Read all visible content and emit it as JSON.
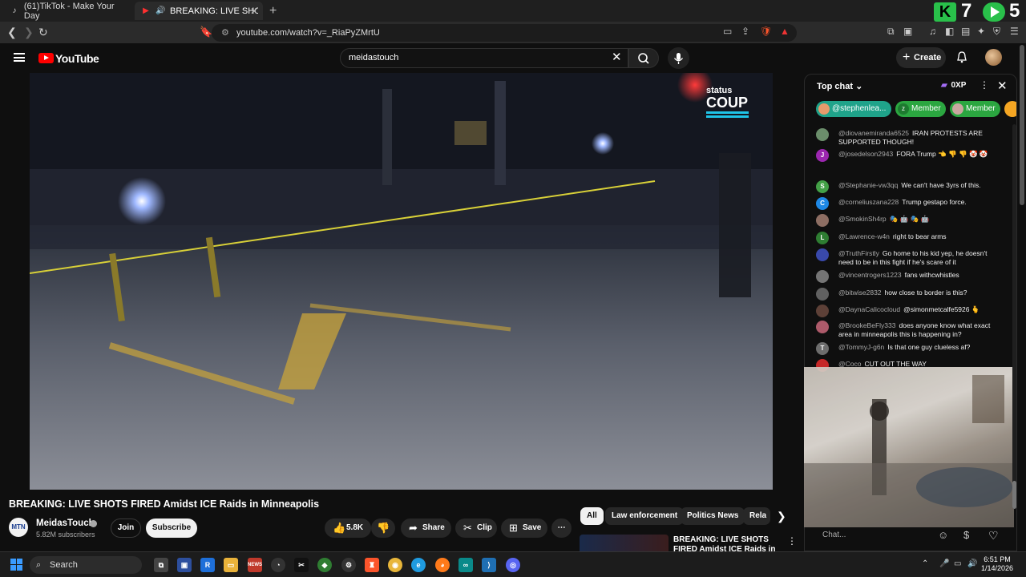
{
  "browser": {
    "tabs": [
      {
        "title": "(61)TikTok - Make Your Day",
        "active": false
      },
      {
        "title": "BREAKING: LIVE SHOTS FIRED",
        "active": true
      }
    ],
    "url": "youtube.com/watch?v=_RiaPyZMrtU",
    "ext_count_a": "7",
    "ext_count_b": "5"
  },
  "header": {
    "logo_text": "YouTube",
    "search_value": "meidastouch",
    "create_label": "Create"
  },
  "video": {
    "title": "BREAKING: LIVE SHOTS FIRED Amidst ICE Raids in Minneapolis",
    "watermark_line1": "status",
    "watermark_line2": "COUP"
  },
  "channel": {
    "avatar_text": "MTN",
    "name": "MeidasTouch",
    "subscribers": "5.82M subscribers",
    "join_label": "Join",
    "subscribe_label": "Subscribe"
  },
  "actions": {
    "likes": "5.8K",
    "share": "Share",
    "clip": "Clip",
    "save": "Save"
  },
  "chips": [
    "All",
    "Law enforcement",
    "Politics News",
    "Rela"
  ],
  "related": {
    "title": "BREAKING: LIVE SHOTS FIRED Amidst ICE Raids in"
  },
  "chat": {
    "mode": "Top chat",
    "xp": "0XP",
    "pinned": [
      {
        "label": "@stephenlea...",
        "color": "#1fa38a"
      },
      {
        "label": "Member",
        "color": "#2ba640"
      },
      {
        "label": "Member",
        "color": "#2ba640"
      }
    ],
    "input_placeholder": "Chat...",
    "messages": [
      {
        "author": "@diovanemiranda6525",
        "text": "IRAN PROTESTS ARE SUPPORTED THOUGH!",
        "color": "#6b8e6b"
      },
      {
        "author": "@josedelson2943",
        "text": "FORA Trump 👈 👎 👎 🤡 🤡",
        "color": "#9c27b0"
      },
      {
        "author": "@Stephanie-vw3qq",
        "text": "We can't have 3yrs of this.",
        "color": "#43a047"
      },
      {
        "author": "@corneliuszana228",
        "text": "Trump gestapo force.",
        "color": "#1e88e5"
      },
      {
        "author": "@SmokinSh4rp",
        "text": "🎭 🤖 🎭 🤖",
        "color": "#8d6e63"
      },
      {
        "author": "@Lawrence-w4n",
        "text": "right to bear arms",
        "color": "#2e7d32"
      },
      {
        "author": "@TruthFirstly",
        "text": "Go home to his kid yep, he doesn't need to be in this fight if he's scare of it",
        "color": "#3949ab"
      },
      {
        "author": "@vincentrogers1223",
        "text": "fans withcwhistles",
        "color": "#757575"
      },
      {
        "author": "@bitwise2832",
        "text": "how close to border is this?",
        "color": "#616161"
      },
      {
        "author": "@DaynaCalicocloud",
        "text": "@simonmetcalfe5926 🫰",
        "color": "#5d4037"
      },
      {
        "author": "@BrookeBeFly333",
        "text": "does anyone know what exact area in minneapolis this is happening in?",
        "color": "#ad5a6a"
      },
      {
        "author": "@TommyJ-g6n",
        "text": "Is that one guy clueless af?",
        "color": "#6d6d6d"
      },
      {
        "author": "@Coco",
        "text": "CUT OUT THE WAY",
        "color": "#c62828"
      }
    ]
  },
  "taskbar": {
    "search_label": "Search",
    "time": "6:51 PM",
    "date": "1/14/2026"
  },
  "colors": {
    "accent": "#ff0000",
    "chat_bg": "#0f0f0f",
    "status_coup_cyan": "#1fc4e8"
  }
}
